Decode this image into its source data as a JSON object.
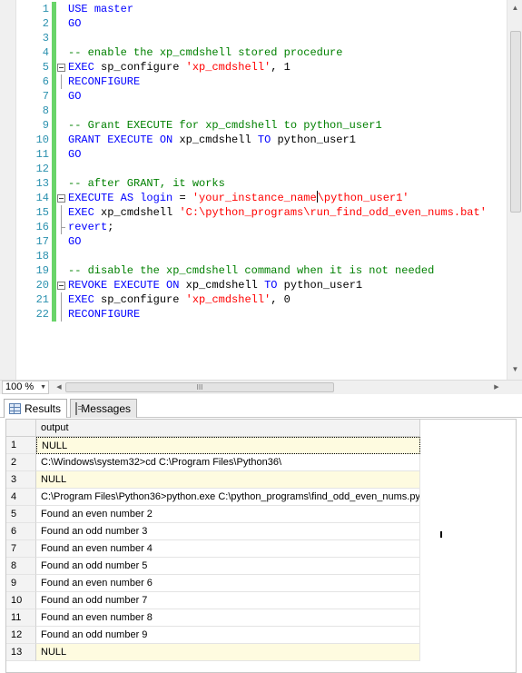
{
  "editor": {
    "line_numbers": [
      "1",
      "2",
      "3",
      "4",
      "5",
      "6",
      "7",
      "8",
      "9",
      "10",
      "11",
      "12",
      "13",
      "14",
      "15",
      "16",
      "17",
      "18",
      "19",
      "20",
      "21",
      "22"
    ],
    "lines": [
      {
        "fold": "",
        "tokens": [
          {
            "t": "kw",
            "v": "USE"
          },
          {
            "t": "txt",
            "v": " "
          },
          {
            "t": "kw",
            "v": "master"
          }
        ]
      },
      {
        "fold": "",
        "tokens": [
          {
            "t": "kw",
            "v": "GO"
          }
        ]
      },
      {
        "fold": "",
        "tokens": []
      },
      {
        "fold": "",
        "tokens": [
          {
            "t": "cmt",
            "v": "-- enable the xp_cmdshell stored procedure"
          }
        ]
      },
      {
        "fold": "open",
        "tokens": [
          {
            "t": "kw",
            "v": "EXEC"
          },
          {
            "t": "txt",
            "v": " sp_configure "
          },
          {
            "t": "str",
            "v": "'xp_cmdshell'"
          },
          {
            "t": "txt",
            "v": ", 1"
          }
        ]
      },
      {
        "fold": "line",
        "tokens": [
          {
            "t": "kw",
            "v": "RECONFIGURE"
          }
        ]
      },
      {
        "fold": "",
        "tokens": [
          {
            "t": "kw",
            "v": "GO"
          }
        ]
      },
      {
        "fold": "",
        "tokens": []
      },
      {
        "fold": "",
        "tokens": [
          {
            "t": "cmt",
            "v": "-- Grant EXECUTE for xp_cmdshell to python_user1"
          }
        ]
      },
      {
        "fold": "",
        "tokens": [
          {
            "t": "kw",
            "v": "GRANT"
          },
          {
            "t": "txt",
            "v": " "
          },
          {
            "t": "kw",
            "v": "EXECUTE"
          },
          {
            "t": "txt",
            "v": " "
          },
          {
            "t": "kw",
            "v": "ON"
          },
          {
            "t": "txt",
            "v": " xp_cmdshell "
          },
          {
            "t": "kw",
            "v": "TO"
          },
          {
            "t": "txt",
            "v": " python_user1"
          }
        ]
      },
      {
        "fold": "",
        "tokens": [
          {
            "t": "kw",
            "v": "GO"
          }
        ]
      },
      {
        "fold": "",
        "tokens": []
      },
      {
        "fold": "",
        "tokens": [
          {
            "t": "cmt",
            "v": "-- after GRANT, it works"
          }
        ]
      },
      {
        "fold": "open",
        "tokens": [
          {
            "t": "kw",
            "v": "EXECUTE"
          },
          {
            "t": "txt",
            "v": " "
          },
          {
            "t": "kw",
            "v": "AS"
          },
          {
            "t": "txt",
            "v": " "
          },
          {
            "t": "kw",
            "v": "login"
          },
          {
            "t": "txt",
            "v": " = "
          },
          {
            "t": "str",
            "v": "'your_instance_name"
          },
          {
            "t": "caret",
            "v": ""
          },
          {
            "t": "str",
            "v": "\\python_user1'"
          }
        ]
      },
      {
        "fold": "line",
        "tokens": [
          {
            "t": "kw",
            "v": "EXEC"
          },
          {
            "t": "txt",
            "v": " xp_cmdshell "
          },
          {
            "t": "str",
            "v": "'C:\\python_programs\\run_find_odd_even_nums.bat'"
          }
        ]
      },
      {
        "fold": "end",
        "tokens": [
          {
            "t": "kw",
            "v": "revert"
          },
          {
            "t": "txt",
            "v": ";"
          }
        ]
      },
      {
        "fold": "",
        "tokens": [
          {
            "t": "kw",
            "v": "GO"
          }
        ]
      },
      {
        "fold": "",
        "tokens": []
      },
      {
        "fold": "",
        "tokens": [
          {
            "t": "cmt",
            "v": "-- disable the xp_cmdshell command when it is not needed"
          }
        ]
      },
      {
        "fold": "open",
        "tokens": [
          {
            "t": "kw",
            "v": "REVOKE"
          },
          {
            "t": "txt",
            "v": " "
          },
          {
            "t": "kw",
            "v": "EXECUTE"
          },
          {
            "t": "txt",
            "v": " "
          },
          {
            "t": "kw",
            "v": "ON"
          },
          {
            "t": "txt",
            "v": " xp_cmdshell "
          },
          {
            "t": "kw",
            "v": "TO"
          },
          {
            "t": "txt",
            "v": " python_user1"
          }
        ]
      },
      {
        "fold": "line",
        "tokens": [
          {
            "t": "kw",
            "v": "EXEC"
          },
          {
            "t": "txt",
            "v": " sp_configure "
          },
          {
            "t": "str",
            "v": "'xp_cmdshell'"
          },
          {
            "t": "txt",
            "v": ", 0"
          }
        ]
      },
      {
        "fold": "line",
        "tokens": [
          {
            "t": "kw",
            "v": "RECONFIGURE"
          }
        ]
      }
    ]
  },
  "zoom": {
    "value": "100 %"
  },
  "hscroll": {
    "thumb_grip": "III"
  },
  "tabs": {
    "results_label": "Results",
    "messages_label": "Messages"
  },
  "grid": {
    "column_header": "output",
    "rows": [
      {
        "num": "1",
        "value": "NULL",
        "is_null": true,
        "selected": true
      },
      {
        "num": "2",
        "value": "C:\\Windows\\system32>cd C:\\Program Files\\Python36\\",
        "is_null": false,
        "selected": false
      },
      {
        "num": "3",
        "value": "NULL",
        "is_null": true,
        "selected": false
      },
      {
        "num": "4",
        "value": "C:\\Program Files\\Python36>python.exe C:\\python_programs\\find_odd_even_nums.py",
        "is_null": false,
        "selected": false
      },
      {
        "num": "5",
        "value": "Found an even number 2",
        "is_null": false,
        "selected": false
      },
      {
        "num": "6",
        "value": "Found an odd number 3",
        "is_null": false,
        "selected": false
      },
      {
        "num": "7",
        "value": "Found an even number 4",
        "is_null": false,
        "selected": false
      },
      {
        "num": "8",
        "value": "Found an odd number 5",
        "is_null": false,
        "selected": false
      },
      {
        "num": "9",
        "value": "Found an even number 6",
        "is_null": false,
        "selected": false
      },
      {
        "num": "10",
        "value": "Found an odd number 7",
        "is_null": false,
        "selected": false
      },
      {
        "num": "11",
        "value": "Found an even number 8",
        "is_null": false,
        "selected": false
      },
      {
        "num": "12",
        "value": "Found an odd number 9",
        "is_null": false,
        "selected": false
      },
      {
        "num": "13",
        "value": "NULL",
        "is_null": true,
        "selected": false
      }
    ]
  },
  "icons": {
    "results_tab": "grid-icon",
    "messages_tab": "messages-icon",
    "scroll_up": "arrow-up-icon",
    "scroll_down": "arrow-down-icon",
    "scroll_left": "arrow-left-icon",
    "scroll_right": "arrow-right-icon",
    "zoom_dropdown": "chevron-down-icon"
  }
}
